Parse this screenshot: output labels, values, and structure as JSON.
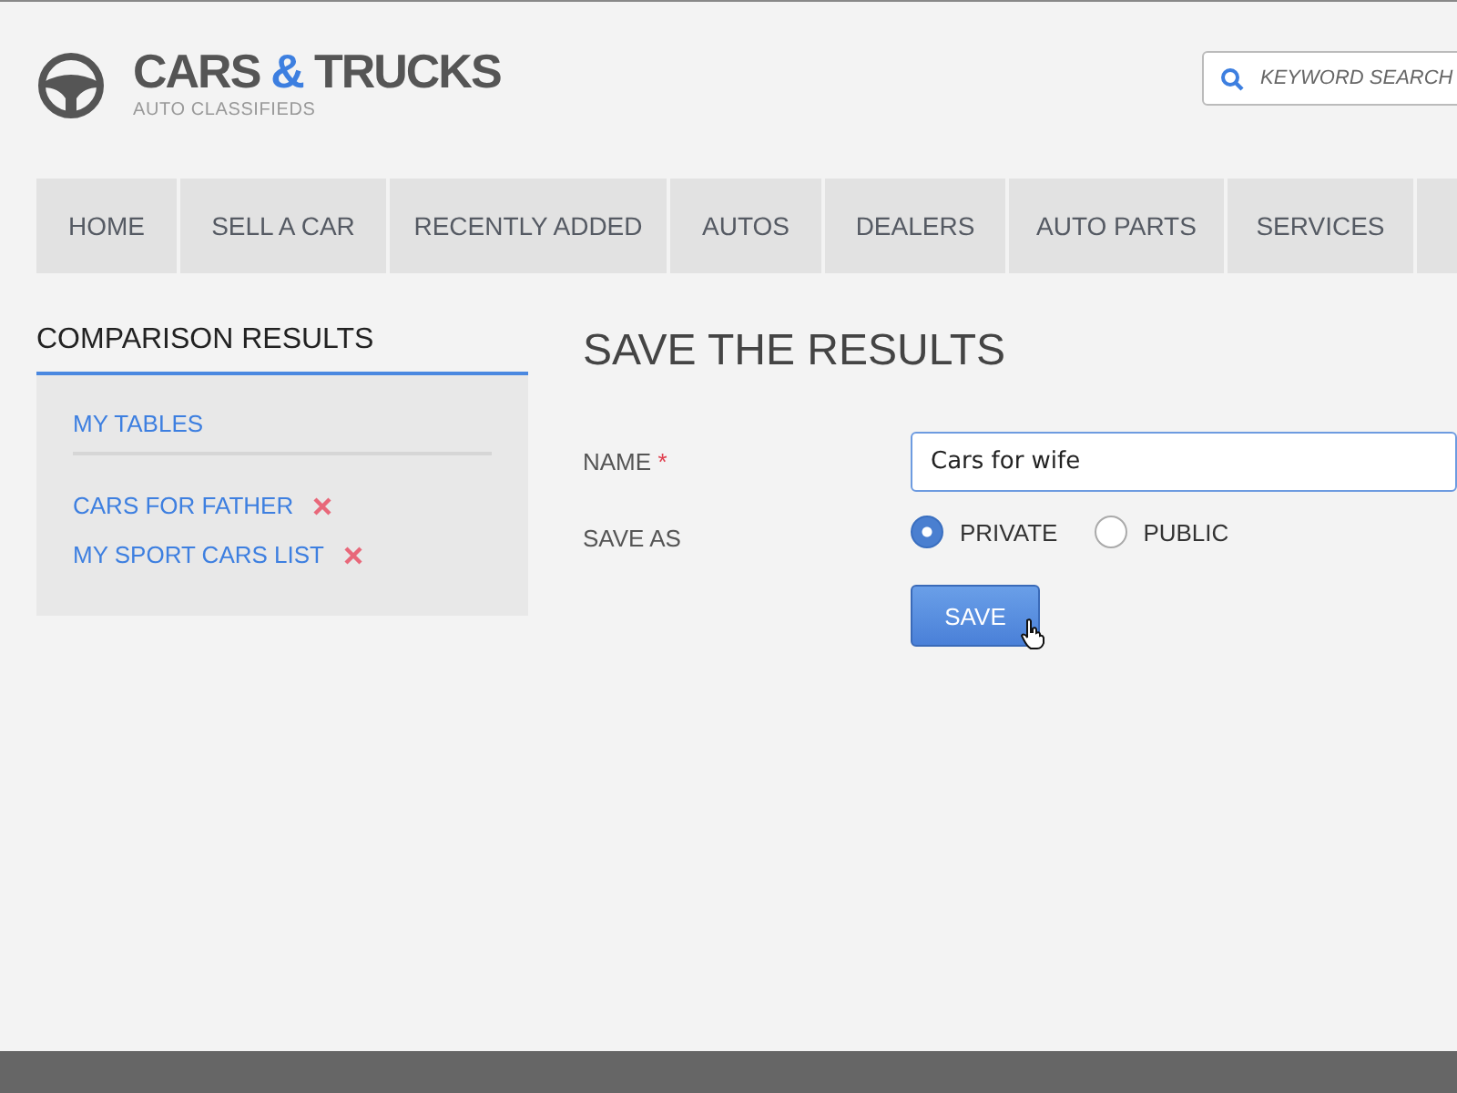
{
  "header": {
    "logo": {
      "title_parts": [
        {
          "text": "CARS",
          "accent": false
        },
        {
          "text": "&",
          "accent": true
        },
        {
          "text": "TRUCKS",
          "accent": false
        }
      ],
      "tagline": "AUTO CLASSIFIEDS"
    },
    "search": {
      "placeholder": "KEYWORD SEARCH"
    }
  },
  "nav": {
    "items": [
      {
        "label": "HOME"
      },
      {
        "label": "SELL A CAR"
      },
      {
        "label": "RECENTLY ADDED"
      },
      {
        "label": "AUTOS"
      },
      {
        "label": "DEALERS"
      },
      {
        "label": "AUTO PARTS"
      },
      {
        "label": "SERVICES"
      }
    ]
  },
  "sidebar": {
    "title": "COMPARISON RESULTS",
    "section": "MY TABLES",
    "items": [
      {
        "label": "CARS FOR FATHER"
      },
      {
        "label": "MY SPORT CARS LIST"
      }
    ]
  },
  "form": {
    "title": "SAVE THE RESULTS",
    "name_label": "NAME",
    "required_mark": "*",
    "name_value": "Cars for wife",
    "save_as_label": "SAVE AS",
    "options": [
      {
        "label": "PRIVATE",
        "selected": true
      },
      {
        "label": "PUBLIC",
        "selected": false
      }
    ],
    "button": "SAVE"
  }
}
